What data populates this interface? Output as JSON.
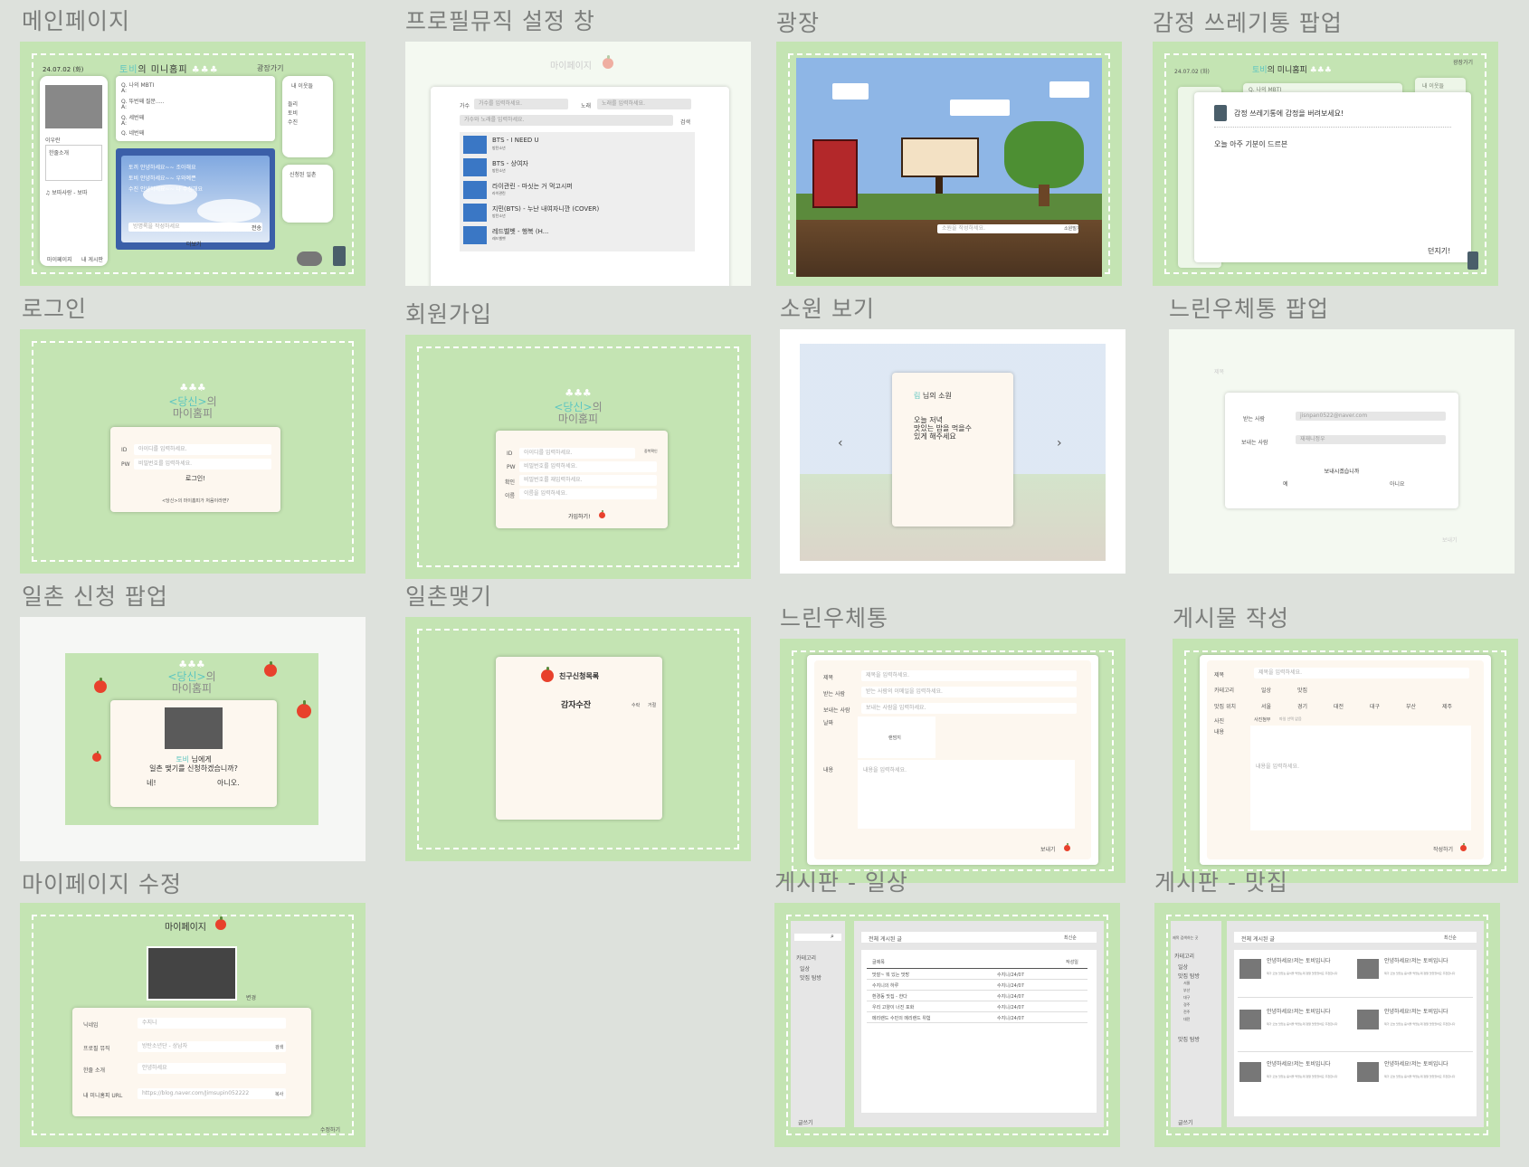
{
  "frames": {
    "main": "메인페이지",
    "profile_music": "프로필뮤직 설정 창",
    "plaza": "광장",
    "trash_popup": "감정 쓰레기통 팝업",
    "login": "로그인",
    "signup": "회원가입",
    "wish_view": "소원 보기",
    "slow_mail_popup": "느린우체통 팝업",
    "ilchon_popup": "일촌 신청 팝업",
    "ilchon": "일촌맺기",
    "slow_mail": "느린우체통",
    "post_write": "게시물 작성",
    "mypage_edit": "마이페이지 수정",
    "board_daily": "게시판 - 일상",
    "board_food": "게시판 - 맛집"
  },
  "main": {
    "date": "24.07.02 (화)",
    "owner": "토비",
    "title_suffix": "의 미니홈피",
    "dots": "♣♣♣",
    "plaza_link": "광장가기",
    "q1": "Q. 나의 MBTI",
    "q2": "Q. 뚜번째 질문.....",
    "q3": "Q. 세번째",
    "q4": "Q. 네번째",
    "a": "A:",
    "nick": "이우란",
    "intro": "한줄소개",
    "music": "♫ 보따사랑 - 보따",
    "neighbors": "내 이웃들",
    "ranking": "신청된 일촌",
    "n1": "들리",
    "n2": "토비",
    "n3": "수진",
    "w1": "토끼 안녕하세요~~ 조아해요",
    "w2": "토비 안녕하세요~~ 우와예쁜",
    "w3": "수진 안녕하세요~~ 나 수정해요",
    "ph": "방명록을 작성하세요",
    "send": "전송",
    "b1": "마이페이지",
    "b2": "내 게시판",
    "more": "더보기"
  },
  "profile": {
    "title": "마이페이지",
    "singer": "가수",
    "song": "노래",
    "ph_singer": "가수를 입력하세요.",
    "ph_song": "노래를 입력하세요.",
    "ph_all": "가수와 노래를 입력하세요.",
    "search": "검색",
    "songs": [
      {
        "t": "BTS - I NEED U",
        "a": "방탄소년"
      },
      {
        "t": "BTS - 상여자",
        "a": "방탄소년"
      },
      {
        "t": "라이관린 - 마싯는 거 먹고시퍼",
        "a": "라이관린"
      },
      {
        "t": "지민(BTS) - 누난 내여자니깐 (COVER)",
        "a": "방탄소년"
      },
      {
        "t": "레드벨벳 - 행복 (H...",
        "a": "레드벨벳"
      }
    ]
  },
  "plaza": {
    "ph": "소원을 작성하세요.",
    "btn": "소원빌기"
  },
  "trash": {
    "date": "24.07.02 (화)",
    "owner": "토비",
    "suffix": "의 미니홈피",
    "dots": "♣♣♣",
    "plaza": "광장가기",
    "q": "Q. 나의 MBTI",
    "neighbors": "내 이웃들",
    "title": "감정 쓰레기통에 감정을 버려보세요!",
    "text": "오늘 아주 기분이 드르븐",
    "throw": "던지기!"
  },
  "login": {
    "dots": "♣♣♣",
    "you": "<당신>",
    "suffix": "의",
    "home": "마이홈피",
    "id": "ID",
    "pw": "PW",
    "ph_id": "아이디를 입력하세요.",
    "ph_pw": "비밀번호를 입력하세요.",
    "btn": "로그인!",
    "link": "<당신>의 마이홈피가 처음이라면?"
  },
  "signup": {
    "id": "ID",
    "pw": "PW",
    "confirm": "확인",
    "name": "이름",
    "ph_id": "아이디를 입력하세요.",
    "ph_pw": "비밀번호를 입력하세요.",
    "ph_c": "비밀번호를 재입력하세요.",
    "ph_n": "이름을 입력하세요.",
    "dup": "중복확인",
    "btn": "가입하기!"
  },
  "wish": {
    "name": "림",
    "suffix": " 님의 소원",
    "text": "오늘 저녁\n맛있는 밥을 먹을수\n있게 해주세요"
  },
  "slowpop": {
    "recv": "받는 사람",
    "send": "보내는 사람",
    "email": "jisnpan0522@naver.com",
    "sender": "재재니정우",
    "q": "보내시겠습니까",
    "yes": "예",
    "no": "아니요",
    "title": "제목",
    "bg": "보내기"
  },
  "ilpop": {
    "dots": "♣♣♣",
    "you": "<당신>",
    "suffix": "의",
    "home": "마이홈피",
    "name": "토비",
    "msg1": " 님에게",
    "msg2": "일촌 맺기를 신청하겠습니까?",
    "yes": "네!",
    "no": "아니오."
  },
  "ilchon": {
    "title": "친구신청목록",
    "name": "감자수잔",
    "accept": "수락",
    "reject": "거절"
  },
  "slowmail": {
    "title": "제목",
    "recv": "받는 사람",
    "sender": "보내는 사람",
    "date": "날짜",
    "content": "내용",
    "ph_t": "제목을 입력하세요.",
    "ph_r": "받는 사람의 이메일을 입력하세요.",
    "ph_s": "보내는 사람을 입력하세요.",
    "pick": "랜덤지",
    "ph_c": "내용을 입력하세요.",
    "send": "보내기"
  },
  "postwrite": {
    "title": "제목",
    "cat": "카테고리",
    "loc": "맛집 위치",
    "photo": "사진",
    "content": "내용",
    "ph_t": "제목을 입력하세요.",
    "c1": "일상",
    "c2": "맛집",
    "locs": [
      "서울",
      "경기",
      "대전",
      "대구",
      "부산",
      "제주"
    ],
    "attach": "사진첨부",
    "fn": "파일 선택 없음",
    "ph_c": "내용을 입력하세요.",
    "btn": "작성하기"
  },
  "mypage": {
    "title": "마이페이지",
    "change": "변경",
    "nick": "닉네임",
    "music": "프로필 뮤직",
    "intro": "한줄 소개",
    "url": "내 미니홈피 URL",
    "v_nick": "수지니",
    "v_music": "방탄소년단 - 상남자",
    "v_intro": "안녕하세요",
    "v_url": "https://blog.naver.com/Jimsupin052222",
    "search": "검색",
    "copy": "복사",
    "save": "수정하기"
  },
  "board1": {
    "cat": "카테고리",
    "c1": "일상",
    "c2": "맛집 탐방",
    "all": "전체 게시된 글",
    "sort": "최신순",
    "h1": "글제목",
    "h2": "작성일",
    "write": "글쓰기",
    "rows": [
      "맛잘~ 뭐 있는 맛방",
      "수지니의 하루",
      "환경동 맛집 - 한다",
      "우리 고양이 너진 포화",
      "메리랜드 수민의 메리랜드 위험"
    ],
    "author": "수지니/24/07"
  },
  "board2": {
    "search": "제목 검색하는 곳",
    "cat": "카테고리",
    "c1": "일상",
    "c2": "맛집 탐방",
    "c3": "맛집 탐방",
    "regions": [
      "서울",
      "부산",
      "대구",
      "경주",
      "전주",
      "대전"
    ],
    "all": "전체 게시된 글",
    "sort": "최신순",
    "card_t": "안녕하세요!저는 토비입니다",
    "card_d": "제가 오늘 맛있는 음식을 먹었는데 정말 맛있었어요 추천합니다",
    "card_a": "토비 ♡",
    "write": "글쓰기"
  }
}
